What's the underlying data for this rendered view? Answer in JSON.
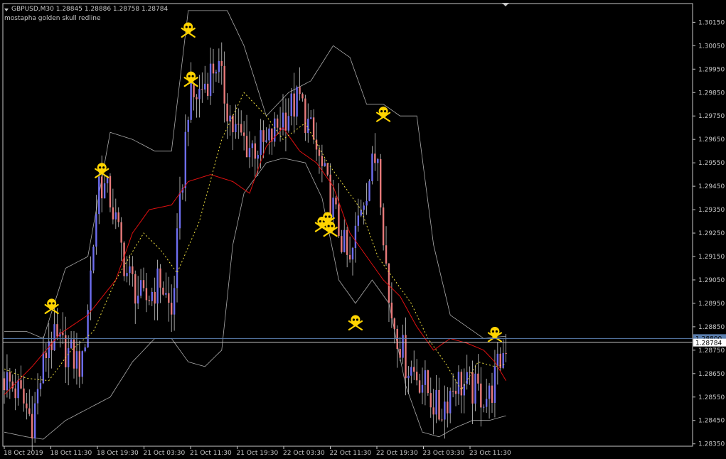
{
  "header": {
    "symbol_line": "GBPUSD,M30  1.28845 1.28886 1.28758 1.28784",
    "indicator_name": "mostapha golden skull redline"
  },
  "colors": {
    "background": "#000000",
    "frame": "#c8c8c8",
    "bull_candle": "#6e6ef0",
    "bear_candle": "#e87a7a",
    "wick": "#c8c8c8",
    "envelope": "#c8c8c8",
    "redline": "#e01010",
    "yellow_dotted": "#f0e040",
    "bid_line": "#c8c8c8",
    "ask_line": "#5b7fb0",
    "skull": "#ffd400"
  },
  "chart_data": {
    "type": "candlestick",
    "title": "GBPUSD,M30",
    "ylim": [
      1.2834,
      1.3023
    ],
    "y_ticks": [
      "1.30150",
      "1.30050",
      "1.29950",
      "1.29850",
      "1.29750",
      "1.29650",
      "1.29550",
      "1.29450",
      "1.29350",
      "1.29250",
      "1.29150",
      "1.29050",
      "1.28950",
      "1.28850",
      "1.28750",
      "1.28650",
      "1.28550",
      "1.28450",
      "1.28350"
    ],
    "x_ticks": [
      "18 Oct 2019",
      "18 Oct 11:30",
      "18 Oct 19:30",
      "21 Oct 03:30",
      "21 Oct 11:30",
      "21 Oct 19:30",
      "22 Oct 03:30",
      "22 Oct 11:30",
      "22 Oct 19:30",
      "23 Oct 03:30",
      "23 Oct 11:30"
    ],
    "last_price": "1.28784",
    "ask_price": "1.28800",
    "close_anchors": [
      [
        0,
        1.2863
      ],
      [
        5,
        1.2857
      ],
      [
        10,
        1.2845
      ],
      [
        16,
        1.288
      ],
      [
        22,
        1.2875
      ],
      [
        28,
        1.2868
      ],
      [
        34,
        1.2948
      ],
      [
        38,
        1.294
      ],
      [
        44,
        1.2908
      ],
      [
        50,
        1.2895
      ],
      [
        56,
        1.2905
      ],
      [
        60,
        1.289
      ],
      [
        66,
        1.298
      ],
      [
        70,
        1.2985
      ],
      [
        76,
        1.2998
      ],
      [
        82,
        1.297
      ],
      [
        88,
        1.2962
      ],
      [
        94,
        1.2962
      ],
      [
        100,
        1.2975
      ],
      [
        106,
        1.2982
      ],
      [
        112,
        1.296
      ],
      [
        118,
        1.2935
      ],
      [
        124,
        1.291
      ],
      [
        128,
        1.2938
      ],
      [
        134,
        1.296
      ],
      [
        138,
        1.2895
      ],
      [
        144,
        1.287
      ],
      [
        150,
        1.2862
      ],
      [
        156,
        1.2848
      ],
      [
        162,
        1.2862
      ],
      [
        168,
        1.2858
      ],
      [
        174,
        1.2855
      ],
      [
        180,
        1.2878
      ]
    ],
    "series": [
      {
        "name": "redline",
        "values": [
          [
            0,
            1.2856
          ],
          [
            10,
            1.2868
          ],
          [
            20,
            1.2882
          ],
          [
            30,
            1.289
          ],
          [
            40,
            1.2905
          ],
          [
            46,
            1.2925
          ],
          [
            52,
            1.2935
          ],
          [
            60,
            1.2937
          ],
          [
            66,
            1.2947
          ],
          [
            74,
            1.295
          ],
          [
            82,
            1.2947
          ],
          [
            88,
            1.2942
          ],
          [
            94,
            1.2962
          ],
          [
            100,
            1.297
          ],
          [
            106,
            1.296
          ],
          [
            112,
            1.2955
          ],
          [
            118,
            1.2945
          ],
          [
            124,
            1.2925
          ],
          [
            130,
            1.2915
          ],
          [
            136,
            1.2905
          ],
          [
            142,
            1.2898
          ],
          [
            148,
            1.2885
          ],
          [
            154,
            1.2875
          ],
          [
            160,
            1.288
          ],
          [
            166,
            1.2878
          ],
          [
            172,
            1.2875
          ],
          [
            176,
            1.287
          ],
          [
            180,
            1.2862
          ]
        ]
      },
      {
        "name": "yellow_dotted",
        "values": [
          [
            0,
            1.2867
          ],
          [
            8,
            1.2863
          ],
          [
            16,
            1.2862
          ],
          [
            24,
            1.2875
          ],
          [
            32,
            1.2883
          ],
          [
            40,
            1.2905
          ],
          [
            50,
            1.2925
          ],
          [
            56,
            1.2918
          ],
          [
            62,
            1.2908
          ],
          [
            70,
            1.293
          ],
          [
            78,
            1.2965
          ],
          [
            86,
            1.2985
          ],
          [
            94,
            1.2975
          ],
          [
            100,
            1.2965
          ],
          [
            108,
            1.2972
          ],
          [
            116,
            1.2955
          ],
          [
            122,
            1.2945
          ],
          [
            128,
            1.2935
          ],
          [
            134,
            1.2915
          ],
          [
            140,
            1.2905
          ],
          [
            146,
            1.2895
          ],
          [
            152,
            1.288
          ],
          [
            158,
            1.287
          ],
          [
            164,
            1.2858
          ],
          [
            170,
            1.287
          ],
          [
            176,
            1.2868
          ],
          [
            180,
            1.2869
          ]
        ]
      },
      {
        "name": "upper_band",
        "values": [
          [
            0,
            1.2883
          ],
          [
            8,
            1.2883
          ],
          [
            14,
            1.288
          ],
          [
            22,
            1.291
          ],
          [
            30,
            1.2915
          ],
          [
            38,
            1.2968
          ],
          [
            46,
            1.2965
          ],
          [
            54,
            1.296
          ],
          [
            60,
            1.296
          ],
          [
            66,
            1.302
          ],
          [
            74,
            1.302
          ],
          [
            80,
            1.302
          ],
          [
            86,
            1.3005
          ],
          [
            94,
            1.2975
          ],
          [
            102,
            1.2985
          ],
          [
            110,
            1.299
          ],
          [
            118,
            1.3005
          ],
          [
            124,
            1.3
          ],
          [
            130,
            1.298
          ],
          [
            136,
            1.298
          ],
          [
            142,
            1.2975
          ],
          [
            148,
            1.2975
          ],
          [
            154,
            1.292
          ],
          [
            160,
            1.289
          ],
          [
            166,
            1.2885
          ],
          [
            172,
            1.288
          ],
          [
            180,
            1.2881
          ]
        ]
      },
      {
        "name": "lower_band",
        "values": [
          [
            0,
            1.284
          ],
          [
            8,
            1.2838
          ],
          [
            14,
            1.2837
          ],
          [
            22,
            1.2845
          ],
          [
            30,
            1.285
          ],
          [
            38,
            1.2855
          ],
          [
            46,
            1.287
          ],
          [
            54,
            1.288
          ],
          [
            60,
            1.288
          ],
          [
            66,
            1.287
          ],
          [
            72,
            1.2868
          ],
          [
            78,
            1.2875
          ],
          [
            82,
            1.292
          ],
          [
            86,
            1.2942
          ],
          [
            94,
            1.2955
          ],
          [
            100,
            1.2957
          ],
          [
            108,
            1.2955
          ],
          [
            114,
            1.294
          ],
          [
            120,
            1.2905
          ],
          [
            126,
            1.2895
          ],
          [
            132,
            1.2905
          ],
          [
            138,
            1.2895
          ],
          [
            144,
            1.286
          ],
          [
            150,
            1.284
          ],
          [
            156,
            1.2838
          ],
          [
            162,
            1.2842
          ],
          [
            168,
            1.2845
          ],
          [
            174,
            1.2845
          ],
          [
            180,
            1.2847
          ]
        ]
      }
    ],
    "skull_markers": [
      [
        17,
        1.2895
      ],
      [
        35,
        1.2953
      ],
      [
        66,
        1.3013
      ],
      [
        67,
        1.2992
      ],
      [
        114,
        1.293
      ],
      [
        116,
        1.2932
      ],
      [
        117,
        1.2928
      ],
      [
        126,
        1.2888
      ],
      [
        136,
        1.2977
      ],
      [
        176,
        1.2883
      ]
    ]
  }
}
